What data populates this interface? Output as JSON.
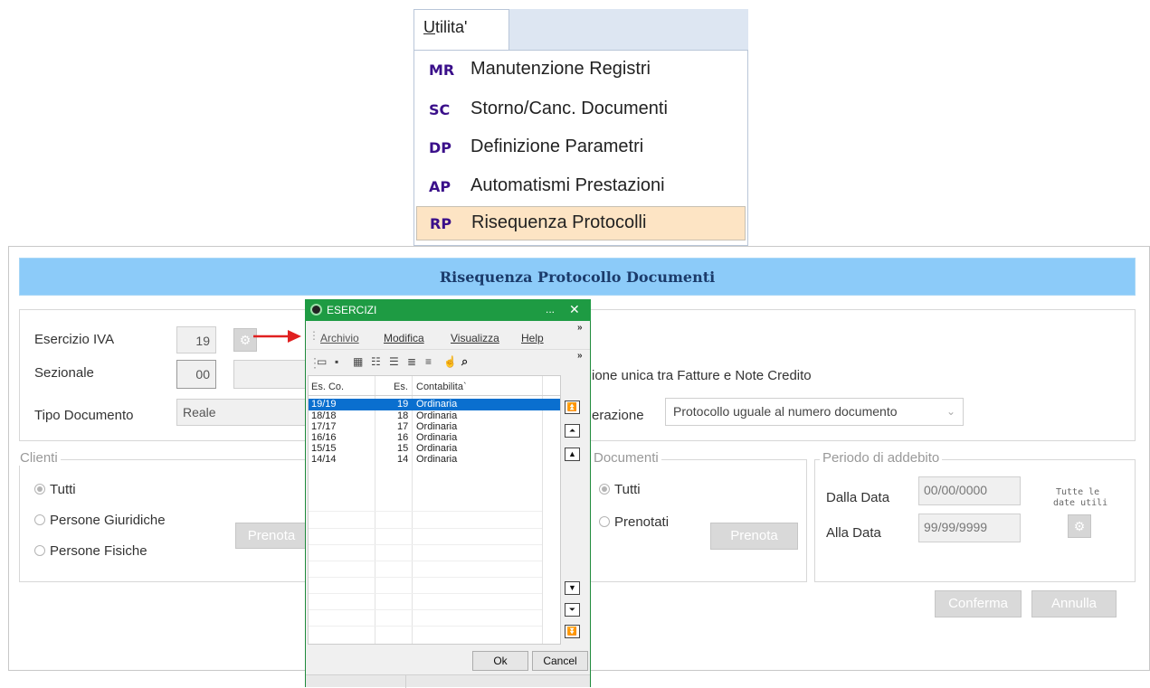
{
  "menu": {
    "title_underline": "U",
    "title_rest": "tilita'",
    "items": [
      {
        "abbr": "MR",
        "label": "Manutenzione Registri"
      },
      {
        "abbr": "SC",
        "label": "Storno/Canc. Documenti"
      },
      {
        "abbr": "DP",
        "label": "Definizione Parametri"
      },
      {
        "abbr": "AP",
        "label": "Automatismi Prestazioni"
      },
      {
        "abbr": "RP",
        "label": "Risequenza Protocolli"
      }
    ]
  },
  "form": {
    "title": "Risequenza Protocollo Documenti",
    "esercizio_label": "Esercizio IVA",
    "esercizio_value": "19",
    "sezionale_label": "Sezionale",
    "sezionale_value": "00",
    "tipo_label": "Tipo Documento",
    "tipo_value": "Reale",
    "numerazione_text": "ione unica tra Fatture e Note Credito",
    "generazione_label": "erazione",
    "generazione_value": "Protocollo uguale al numero documento",
    "clienti_legend": "Clienti",
    "clienti_options": [
      "Tutti",
      "Persone Giuridiche",
      "Persone Fisiche"
    ],
    "clienti_prenota": "Prenota",
    "documenti_legend": "Documenti",
    "documenti_options": [
      "Tutti",
      "Prenotati"
    ],
    "documenti_prenota": "Prenota",
    "periodo_legend": "Periodo di addebito",
    "dalla_label": "Dalla Data",
    "dalla_value": "00/00/0000",
    "alla_label": "Alla Data",
    "alla_value": "99/99/9999",
    "tutte_label_1": "Tutte le",
    "tutte_label_2": "date utili",
    "conferma": "Conferma",
    "annulla": "Annulla"
  },
  "popup": {
    "title": "ESERCIZI",
    "title_dots": "...",
    "title_close": "✕",
    "menu": [
      "Archivio",
      "Modifica",
      "Visualizza",
      "Help"
    ],
    "menu_accel": [
      "A",
      "M",
      "V",
      "H"
    ],
    "columns": [
      "Es. Co.",
      "Es.",
      "Contabilita`"
    ],
    "rows": [
      {
        "esco": "19/19",
        "es": "19",
        "cont": "Ordinaria",
        "selected": true
      },
      {
        "esco": "18/18",
        "es": "18",
        "cont": "Ordinaria"
      },
      {
        "esco": "17/17",
        "es": "17",
        "cont": "Ordinaria"
      },
      {
        "esco": "16/16",
        "es": "16",
        "cont": "Ordinaria"
      },
      {
        "esco": "15/15",
        "es": "15",
        "cont": "Ordinaria"
      },
      {
        "esco": "14/14",
        "es": "14",
        "cont": "Ordinaria"
      }
    ],
    "ok": "Ok",
    "cancel": "Cancel"
  },
  "colors": {
    "title_bar": "#8ccbf9",
    "popup_green": "#1e9b43",
    "selected_row": "#0a6fcf",
    "menu_selected": "#fde4c4",
    "arrow": "#e02020"
  }
}
